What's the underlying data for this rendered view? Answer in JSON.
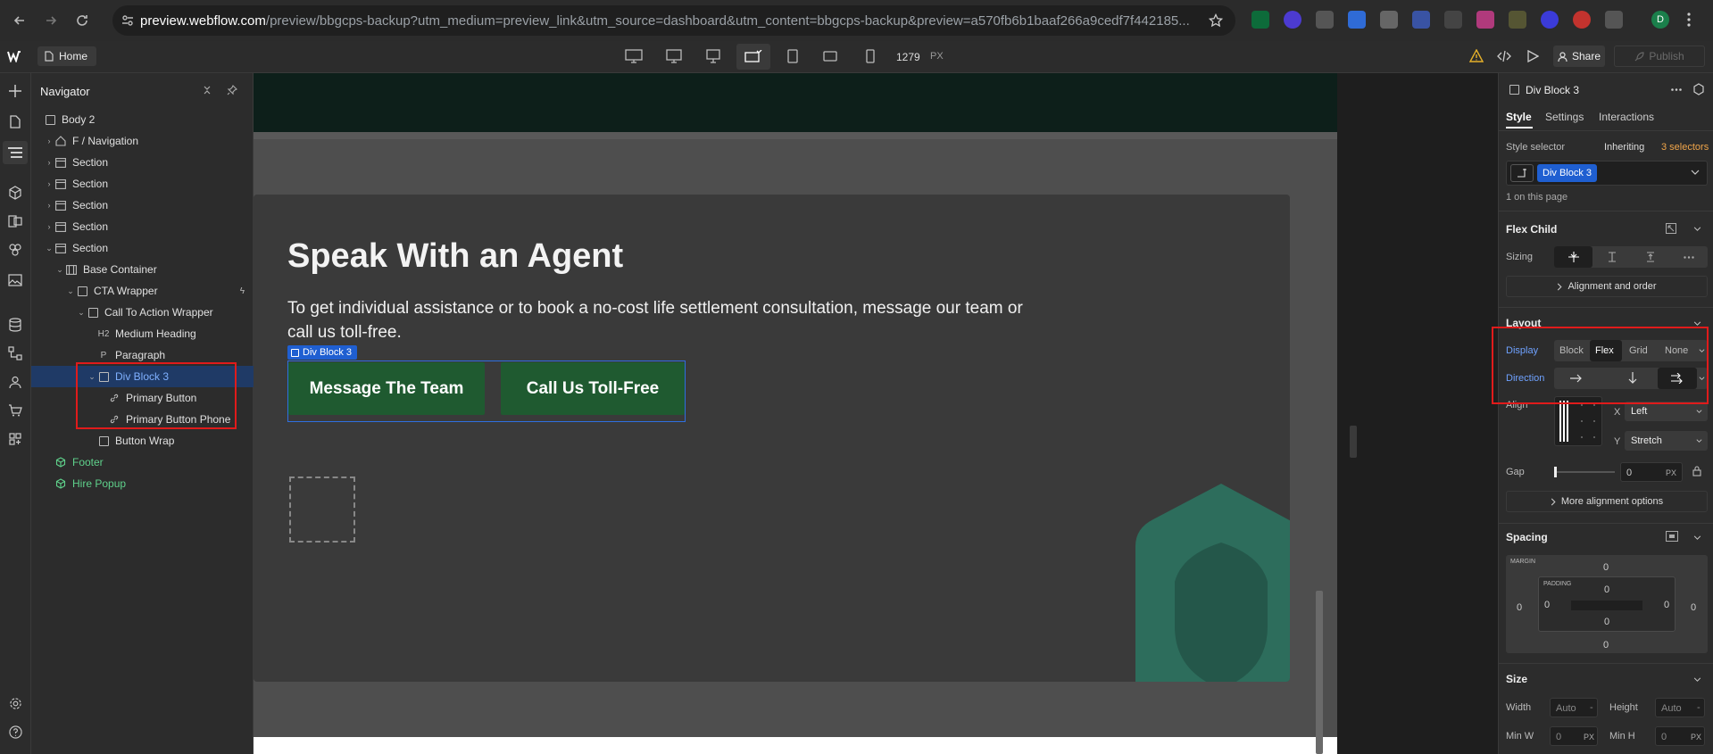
{
  "browser": {
    "url_host": "preview.webflow.com",
    "url_path": "/preview/bbgcps-backup?utm_medium=preview_link&utm_source=dashboard&utm_content=bbgcps-backup&preview=a570fb6b1baaf266a9cedf7f442185..."
  },
  "toolbar": {
    "home_label": "Home",
    "width_value": "1279",
    "width_unit": "PX",
    "share_label": "Share",
    "publish_label": "Publish"
  },
  "navigator": {
    "title": "Navigator",
    "items": [
      {
        "label": "Body 2",
        "depth": 0,
        "icon": "box"
      },
      {
        "label": "F / Navigation",
        "depth": 1,
        "icon": "home"
      },
      {
        "label": "Section",
        "depth": 1,
        "icon": "section"
      },
      {
        "label": "Section",
        "depth": 1,
        "icon": "section"
      },
      {
        "label": "Section",
        "depth": 1,
        "icon": "section"
      },
      {
        "label": "Section",
        "depth": 1,
        "icon": "section"
      },
      {
        "label": "Section",
        "depth": 1,
        "icon": "section"
      },
      {
        "label": "Base Container",
        "depth": 2,
        "icon": "container"
      },
      {
        "label": "CTA Wrapper",
        "depth": 3,
        "icon": "box"
      },
      {
        "label": "Call To Action Wrapper",
        "depth": 4,
        "icon": "box"
      },
      {
        "label": "Medium Heading",
        "depth": 5,
        "icon": "H2"
      },
      {
        "label": "Paragraph",
        "depth": 5,
        "icon": "P"
      },
      {
        "label": "Div Block 3",
        "depth": 5,
        "icon": "box"
      },
      {
        "label": "Primary Button",
        "depth": 6,
        "icon": "link"
      },
      {
        "label": "Primary Button Phone",
        "depth": 6,
        "icon": "link"
      },
      {
        "label": "Button Wrap",
        "depth": 5,
        "icon": "box"
      },
      {
        "label": "Footer",
        "depth": 1,
        "icon": "component"
      },
      {
        "label": "Hire Popup",
        "depth": 1,
        "icon": "component"
      }
    ]
  },
  "canvas": {
    "heading": "Speak With an Agent",
    "paragraph": "To get individual assistance or to book a no-cost life settlement consultation, message our team or call us toll-free.",
    "selected_label": "Div Block 3",
    "btn1": "Message The Team",
    "btn2": "Call Us Toll-Free"
  },
  "panel": {
    "element": "Div Block 3",
    "tabs": [
      "Style",
      "Settings",
      "Interactions"
    ],
    "style_selector": "Style selector",
    "inheriting": "Inheriting",
    "selectors_count": "3 selectors",
    "selector_chip": "Div Block 3",
    "on_page": "1 on this page",
    "flex_child": "Flex Child",
    "sizing": "Sizing",
    "align_order": "Alignment and order",
    "layout": "Layout",
    "display": "Display",
    "display_options": [
      "Block",
      "Flex",
      "Grid",
      "None"
    ],
    "direction": "Direction",
    "align": "Align",
    "x_label": "X",
    "x_value": "Left",
    "y_label": "Y",
    "y_value": "Stretch",
    "gap": "Gap",
    "gap_value": "0",
    "gap_unit": "PX",
    "more_align": "More alignment options",
    "spacing": "Spacing",
    "margin_label": "MARGIN",
    "padding_label": "PADDING",
    "margin": {
      "top": "0",
      "right": "0",
      "bottom": "0",
      "left": "0"
    },
    "padding": {
      "top": "0",
      "right": "0",
      "bottom": "0",
      "left": "0"
    },
    "size": "Size",
    "width": "Width",
    "width_value": "Auto",
    "height": "Height",
    "height_value": "Auto",
    "min_w": "Min W",
    "min_w_value": "0",
    "min_h": "Min H",
    "min_h_value": "0",
    "unit": "PX"
  },
  "colors": {
    "accent": "#1f5fd1",
    "button_green": "#1f5a30",
    "teal": "#2d6d5c",
    "highlight": "#e01b1b"
  }
}
